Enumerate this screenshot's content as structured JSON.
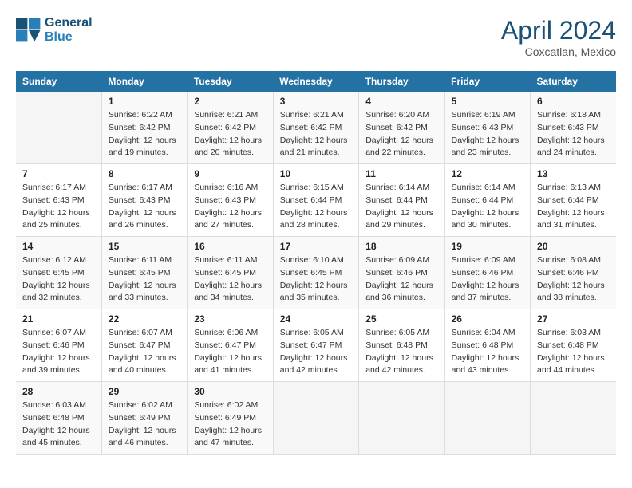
{
  "header": {
    "logo_line1": "General",
    "logo_line2": "Blue",
    "month_title": "April 2024",
    "location": "Coxcatlan, Mexico"
  },
  "days_of_week": [
    "Sunday",
    "Monday",
    "Tuesday",
    "Wednesday",
    "Thursday",
    "Friday",
    "Saturday"
  ],
  "weeks": [
    [
      {
        "day": "",
        "sunrise": "",
        "sunset": "",
        "daylight": ""
      },
      {
        "day": "1",
        "sunrise": "Sunrise: 6:22 AM",
        "sunset": "Sunset: 6:42 PM",
        "daylight": "Daylight: 12 hours and 19 minutes."
      },
      {
        "day": "2",
        "sunrise": "Sunrise: 6:21 AM",
        "sunset": "Sunset: 6:42 PM",
        "daylight": "Daylight: 12 hours and 20 minutes."
      },
      {
        "day": "3",
        "sunrise": "Sunrise: 6:21 AM",
        "sunset": "Sunset: 6:42 PM",
        "daylight": "Daylight: 12 hours and 21 minutes."
      },
      {
        "day": "4",
        "sunrise": "Sunrise: 6:20 AM",
        "sunset": "Sunset: 6:42 PM",
        "daylight": "Daylight: 12 hours and 22 minutes."
      },
      {
        "day": "5",
        "sunrise": "Sunrise: 6:19 AM",
        "sunset": "Sunset: 6:43 PM",
        "daylight": "Daylight: 12 hours and 23 minutes."
      },
      {
        "day": "6",
        "sunrise": "Sunrise: 6:18 AM",
        "sunset": "Sunset: 6:43 PM",
        "daylight": "Daylight: 12 hours and 24 minutes."
      }
    ],
    [
      {
        "day": "7",
        "sunrise": "Sunrise: 6:17 AM",
        "sunset": "Sunset: 6:43 PM",
        "daylight": "Daylight: 12 hours and 25 minutes."
      },
      {
        "day": "8",
        "sunrise": "Sunrise: 6:17 AM",
        "sunset": "Sunset: 6:43 PM",
        "daylight": "Daylight: 12 hours and 26 minutes."
      },
      {
        "day": "9",
        "sunrise": "Sunrise: 6:16 AM",
        "sunset": "Sunset: 6:43 PM",
        "daylight": "Daylight: 12 hours and 27 minutes."
      },
      {
        "day": "10",
        "sunrise": "Sunrise: 6:15 AM",
        "sunset": "Sunset: 6:44 PM",
        "daylight": "Daylight: 12 hours and 28 minutes."
      },
      {
        "day": "11",
        "sunrise": "Sunrise: 6:14 AM",
        "sunset": "Sunset: 6:44 PM",
        "daylight": "Daylight: 12 hours and 29 minutes."
      },
      {
        "day": "12",
        "sunrise": "Sunrise: 6:14 AM",
        "sunset": "Sunset: 6:44 PM",
        "daylight": "Daylight: 12 hours and 30 minutes."
      },
      {
        "day": "13",
        "sunrise": "Sunrise: 6:13 AM",
        "sunset": "Sunset: 6:44 PM",
        "daylight": "Daylight: 12 hours and 31 minutes."
      }
    ],
    [
      {
        "day": "14",
        "sunrise": "Sunrise: 6:12 AM",
        "sunset": "Sunset: 6:45 PM",
        "daylight": "Daylight: 12 hours and 32 minutes."
      },
      {
        "day": "15",
        "sunrise": "Sunrise: 6:11 AM",
        "sunset": "Sunset: 6:45 PM",
        "daylight": "Daylight: 12 hours and 33 minutes."
      },
      {
        "day": "16",
        "sunrise": "Sunrise: 6:11 AM",
        "sunset": "Sunset: 6:45 PM",
        "daylight": "Daylight: 12 hours and 34 minutes."
      },
      {
        "day": "17",
        "sunrise": "Sunrise: 6:10 AM",
        "sunset": "Sunset: 6:45 PM",
        "daylight": "Daylight: 12 hours and 35 minutes."
      },
      {
        "day": "18",
        "sunrise": "Sunrise: 6:09 AM",
        "sunset": "Sunset: 6:46 PM",
        "daylight": "Daylight: 12 hours and 36 minutes."
      },
      {
        "day": "19",
        "sunrise": "Sunrise: 6:09 AM",
        "sunset": "Sunset: 6:46 PM",
        "daylight": "Daylight: 12 hours and 37 minutes."
      },
      {
        "day": "20",
        "sunrise": "Sunrise: 6:08 AM",
        "sunset": "Sunset: 6:46 PM",
        "daylight": "Daylight: 12 hours and 38 minutes."
      }
    ],
    [
      {
        "day": "21",
        "sunrise": "Sunrise: 6:07 AM",
        "sunset": "Sunset: 6:46 PM",
        "daylight": "Daylight: 12 hours and 39 minutes."
      },
      {
        "day": "22",
        "sunrise": "Sunrise: 6:07 AM",
        "sunset": "Sunset: 6:47 PM",
        "daylight": "Daylight: 12 hours and 40 minutes."
      },
      {
        "day": "23",
        "sunrise": "Sunrise: 6:06 AM",
        "sunset": "Sunset: 6:47 PM",
        "daylight": "Daylight: 12 hours and 41 minutes."
      },
      {
        "day": "24",
        "sunrise": "Sunrise: 6:05 AM",
        "sunset": "Sunset: 6:47 PM",
        "daylight": "Daylight: 12 hours and 42 minutes."
      },
      {
        "day": "25",
        "sunrise": "Sunrise: 6:05 AM",
        "sunset": "Sunset: 6:48 PM",
        "daylight": "Daylight: 12 hours and 42 minutes."
      },
      {
        "day": "26",
        "sunrise": "Sunrise: 6:04 AM",
        "sunset": "Sunset: 6:48 PM",
        "daylight": "Daylight: 12 hours and 43 minutes."
      },
      {
        "day": "27",
        "sunrise": "Sunrise: 6:03 AM",
        "sunset": "Sunset: 6:48 PM",
        "daylight": "Daylight: 12 hours and 44 minutes."
      }
    ],
    [
      {
        "day": "28",
        "sunrise": "Sunrise: 6:03 AM",
        "sunset": "Sunset: 6:48 PM",
        "daylight": "Daylight: 12 hours and 45 minutes."
      },
      {
        "day": "29",
        "sunrise": "Sunrise: 6:02 AM",
        "sunset": "Sunset: 6:49 PM",
        "daylight": "Daylight: 12 hours and 46 minutes."
      },
      {
        "day": "30",
        "sunrise": "Sunrise: 6:02 AM",
        "sunset": "Sunset: 6:49 PM",
        "daylight": "Daylight: 12 hours and 47 minutes."
      },
      {
        "day": "",
        "sunrise": "",
        "sunset": "",
        "daylight": ""
      },
      {
        "day": "",
        "sunrise": "",
        "sunset": "",
        "daylight": ""
      },
      {
        "day": "",
        "sunrise": "",
        "sunset": "",
        "daylight": ""
      },
      {
        "day": "",
        "sunrise": "",
        "sunset": "",
        "daylight": ""
      }
    ]
  ]
}
